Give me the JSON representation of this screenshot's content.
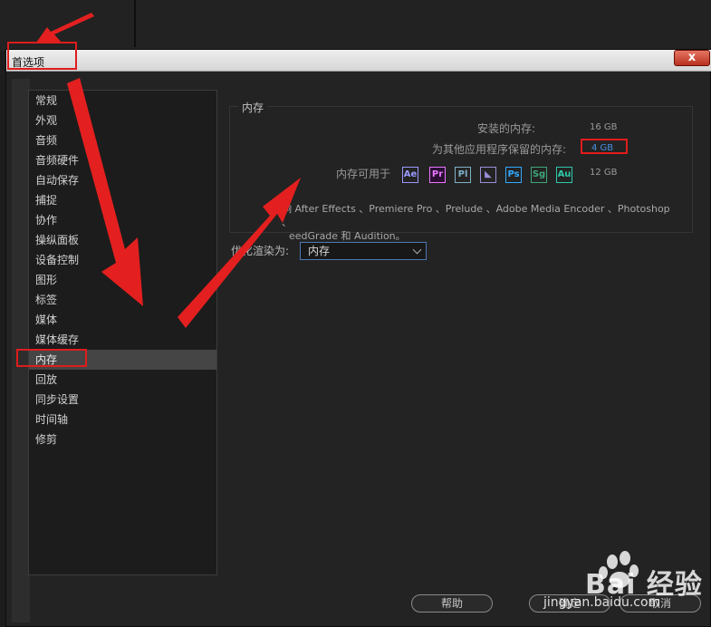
{
  "dialog": {
    "title": "首选项",
    "close_label": "x"
  },
  "sidebar": {
    "items": [
      {
        "label": "常规",
        "selected": false
      },
      {
        "label": "外观",
        "selected": false
      },
      {
        "label": "音频",
        "selected": false
      },
      {
        "label": "音频硬件",
        "selected": false
      },
      {
        "label": "自动保存",
        "selected": false
      },
      {
        "label": "捕捉",
        "selected": false
      },
      {
        "label": "协作",
        "selected": false
      },
      {
        "label": "操纵面板",
        "selected": false
      },
      {
        "label": "设备控制",
        "selected": false
      },
      {
        "label": "图形",
        "selected": false
      },
      {
        "label": "标签",
        "selected": false
      },
      {
        "label": "媒体",
        "selected": false
      },
      {
        "label": "媒体缓存",
        "selected": false
      },
      {
        "label": "内存",
        "selected": true
      },
      {
        "label": "回放",
        "selected": false
      },
      {
        "label": "同步设置",
        "selected": false
      },
      {
        "label": "时间轴",
        "selected": false
      },
      {
        "label": "修剪",
        "selected": false
      }
    ]
  },
  "memory": {
    "group_label": "内存",
    "installed_label": "安装的内存:",
    "installed_value": "16 GB",
    "reserved_label": "为其他应用程序保留的内存:",
    "reserved_value": "4 GB",
    "available_label": "内存可用于",
    "available_value": "12 GB",
    "apps": [
      {
        "abbr": "Ae",
        "color": "#9999ff",
        "name": "After Effects"
      },
      {
        "abbr": "Pr",
        "color": "#ea77ff",
        "name": "Premiere Pro"
      },
      {
        "abbr": "Pl",
        "color": "#7fb0c8",
        "name": "Prelude"
      },
      {
        "abbr": "◣",
        "color": "#9a8fd8",
        "name": "Adobe Media Encoder"
      },
      {
        "abbr": "Ps",
        "color": "#31a8ff",
        "name": "Photoshop"
      },
      {
        "abbr": "Sg",
        "color": "#3fa67a",
        "name": "SpeedGrade"
      },
      {
        "abbr": "Au",
        "color": "#2fc9a8",
        "name": "Audition"
      }
    ],
    "description_line1": "响 After Effects 、Premiere Pro 、Prelude 、Adobe Media Encoder 、Photoshop 、",
    "description_line2": "eedGrade 和 Audition。"
  },
  "render": {
    "label": "优化渲染为:",
    "selected": "内存"
  },
  "buttons": {
    "help": "帮助",
    "ok": "确定",
    "cancel": "取消"
  },
  "watermark": {
    "brand": "Bai 经验",
    "url": "jingyan.baidu.com"
  },
  "colors": {
    "highlight": "#e01c1c",
    "arrow": "#e3201f",
    "accent_blue": "#4a90e2"
  }
}
